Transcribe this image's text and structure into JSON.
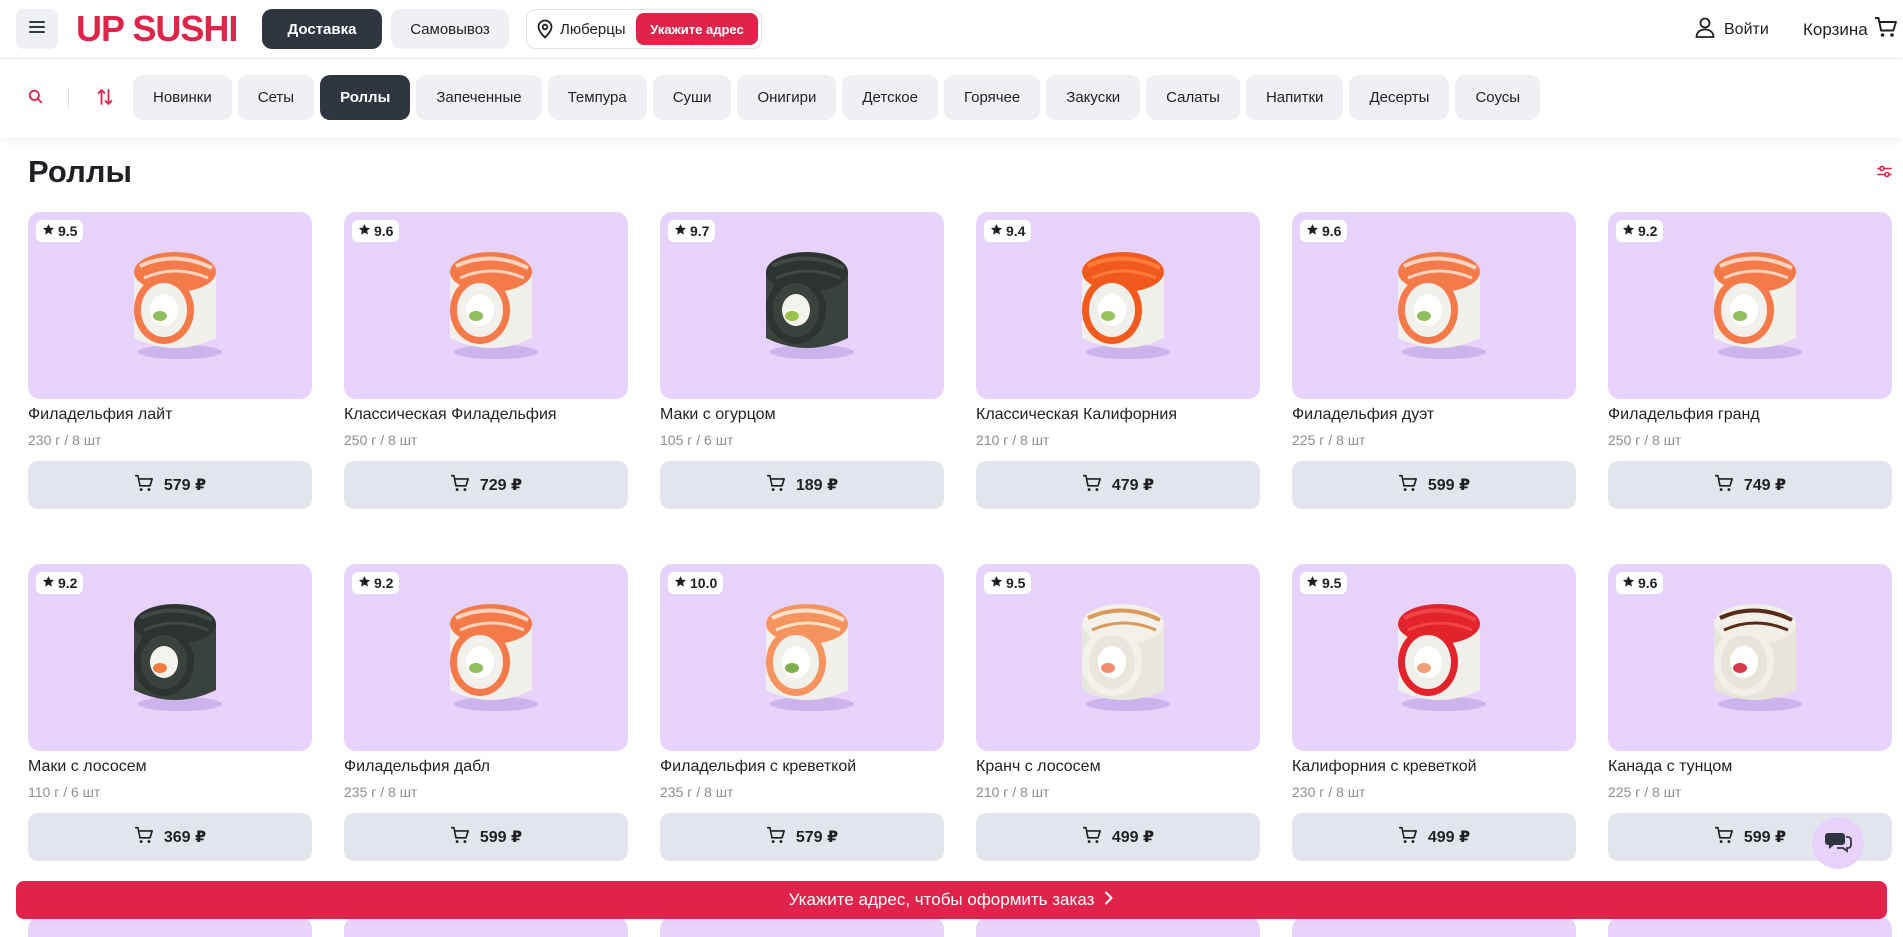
{
  "header": {
    "logo": "UP SUSHI",
    "delivery_label": "Доставка",
    "pickup_label": "Самовывоз",
    "city": "Люберцы",
    "address_button": "Укажите адрес",
    "login_label": "Войти",
    "cart_label": "Корзина"
  },
  "categories": [
    "Новинки",
    "Сеты",
    "Роллы",
    "Запеченные",
    "Темпура",
    "Суши",
    "Онигири",
    "Детское",
    "Горячее",
    "Закуски",
    "Салаты",
    "Напитки",
    "Десерты",
    "Соусы"
  ],
  "active_category": "Роллы",
  "page_title": "Роллы",
  "products_row1": [
    {
      "name": "Филадельфия лайт",
      "weight": "230 г / 8 шт",
      "price": "579 ₽",
      "rating": "9.5",
      "style": "salmon"
    },
    {
      "name": "Классическая Филадельфия",
      "weight": "250 г / 8 шт",
      "price": "729 ₽",
      "rating": "9.6",
      "style": "salmon"
    },
    {
      "name": "Маки с огурцом",
      "weight": "105 г / 6 шт",
      "price": "189 ₽",
      "rating": "9.7",
      "style": "nori-cucumber"
    },
    {
      "name": "Классическая Калифорния",
      "weight": "210 г / 8 шт",
      "price": "479 ₽",
      "rating": "9.4",
      "style": "tobiko-orange"
    },
    {
      "name": "Филадельфия дуэт",
      "weight": "225 г / 8 шт",
      "price": "599 ₽",
      "rating": "9.6",
      "style": "salmon"
    },
    {
      "name": "Филадельфия гранд",
      "weight": "250 г / 8 шт",
      "price": "749 ₽",
      "rating": "9.2",
      "style": "salmon"
    }
  ],
  "products_row2": [
    {
      "name": "Маки с лососем",
      "weight": "110 г / 6 шт",
      "price": "369 ₽",
      "rating": "9.2",
      "style": "nori-salmon"
    },
    {
      "name": "Филадельфия дабл",
      "weight": "235 г / 8 шт",
      "price": "599 ₽",
      "rating": "9.2",
      "style": "salmon"
    },
    {
      "name": "Филадельфия с креветкой",
      "weight": "235 г / 8 шт",
      "price": "579 ₽",
      "rating": "10.0",
      "style": "salmon-light"
    },
    {
      "name": "Кранч с лососем",
      "weight": "210 г / 8 шт",
      "price": "499 ₽",
      "rating": "9.5",
      "style": "rice"
    },
    {
      "name": "Калифорния с креветкой",
      "weight": "230 г / 8 шт",
      "price": "499 ₽",
      "rating": "9.5",
      "style": "tobiko-red"
    },
    {
      "name": "Канада с тунцом",
      "weight": "225 г / 8 шт",
      "price": "599 ₽",
      "rating": "9.6",
      "style": "eel"
    }
  ],
  "bottom_bar_text": "Укажите адрес, чтобы оформить заказ",
  "colors": {
    "brand": "#e0234b",
    "dark": "#2f3640",
    "card_bg": "#e6d2fb",
    "chip_bg": "#eef0f3",
    "button_bg": "#e2e6ec"
  }
}
